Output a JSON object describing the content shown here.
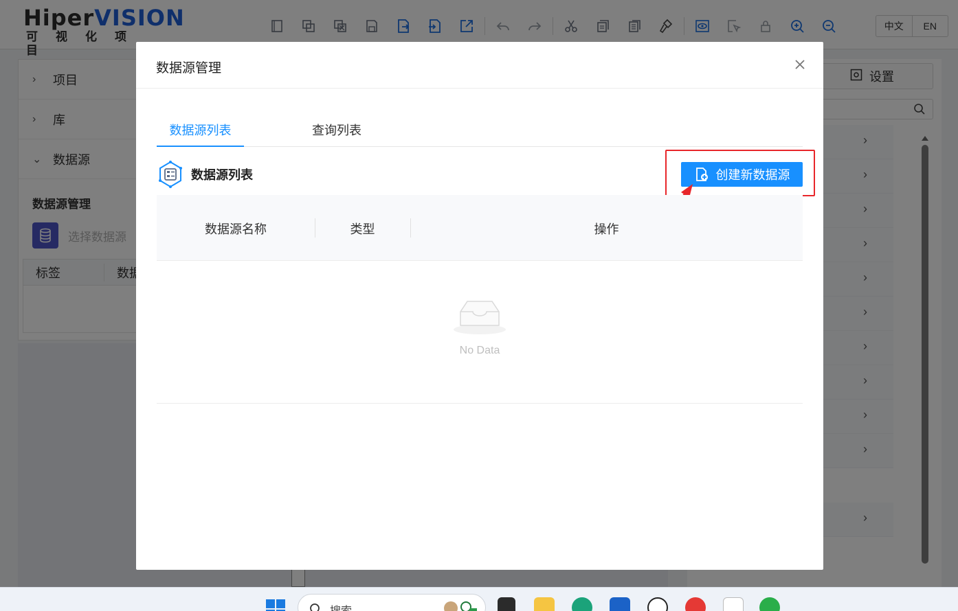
{
  "app": {
    "logo_main_1": "Hiper",
    "logo_main_2": "VISION",
    "logo_sub": "可视化项目",
    "lang_zh": "中文",
    "lang_en": "EN"
  },
  "toolbar": {
    "icons": [
      "new-page-icon",
      "copy-page-icon",
      "delete-page-icon",
      "save-icon",
      "export-icon",
      "import-icon",
      "share-icon",
      "undo-icon",
      "redo-icon",
      "cut-icon",
      "copy-icon",
      "paste-icon",
      "format-brush-icon",
      "preview-icon",
      "select-icon",
      "lock-icon",
      "zoom-in-icon",
      "zoom-out-icon"
    ]
  },
  "left_panel": {
    "items": [
      {
        "label": "项目",
        "expanded": false
      },
      {
        "label": "库",
        "expanded": false
      },
      {
        "label": "数据源",
        "expanded": true
      }
    ],
    "section_title": "数据源管理",
    "select_placeholder": "选择数据源",
    "table_headers": [
      "标签",
      "数据"
    ]
  },
  "right_panel": {
    "settings_label": "设置",
    "row_count": 11
  },
  "modal": {
    "title": "数据源管理",
    "tabs": [
      {
        "label": "数据源列表",
        "active": true
      },
      {
        "label": "查询列表",
        "active": false
      }
    ],
    "section_title": "数据源列表",
    "create_button": "创建新数据源",
    "table": {
      "columns": [
        "数据源名称",
        "类型",
        "操作"
      ],
      "rows": [],
      "empty_text": "No Data"
    }
  },
  "taskbar": {
    "search_label": "搜索"
  },
  "colors": {
    "primary": "#1890ff",
    "highlight": "#e8262a",
    "logo_blue": "#1f5fd6",
    "db_badge": "#4d55c6"
  }
}
